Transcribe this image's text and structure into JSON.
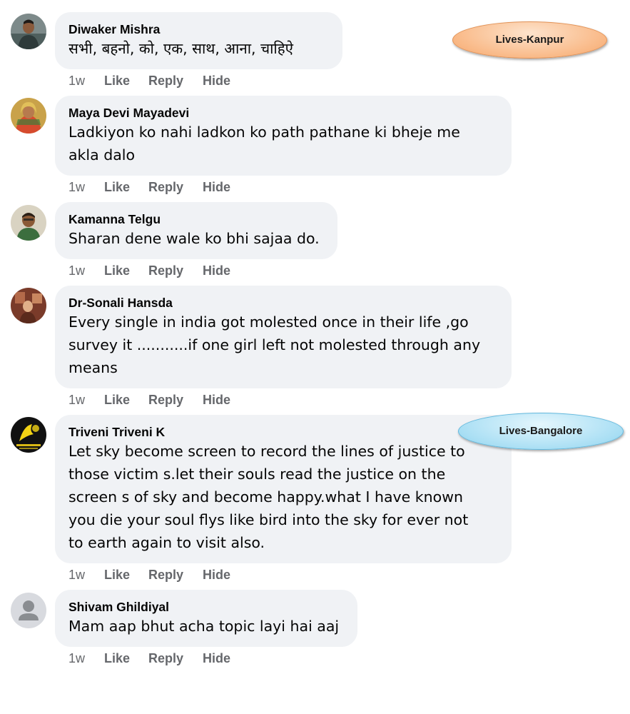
{
  "comments": [
    {
      "author": "Diwaker Mishra",
      "lines": [
        "सभी, बहनो, को, एक, साथ, आना, चाहिऐ"
      ],
      "time": "1w",
      "like": "Like",
      "reply": "Reply",
      "hide": "Hide"
    },
    {
      "author": "Maya Devi Mayadevi",
      "lines": [
        "Ladkiyon ko nahi ladkon ko path pathane ki bheje me",
        "akla dalo"
      ],
      "time": "1w",
      "like": "Like",
      "reply": "Reply",
      "hide": "Hide"
    },
    {
      "author": "Kamanna Telgu",
      "lines": [
        "Sharan dene wale ko bhi sajaa do."
      ],
      "time": "1w",
      "like": "Like",
      "reply": "Reply",
      "hide": "Hide"
    },
    {
      "author": "Dr-Sonali Hansda",
      "lines": [
        "Every single in india got molested once in their life ,go",
        "survey it ...........if one girl left not molested through any",
        "means"
      ],
      "time": "1w",
      "like": "Like",
      "reply": "Reply",
      "hide": "Hide"
    },
    {
      "author": "Triveni Triveni K",
      "lines": [
        "Let sky become screen to record the lines of justice to",
        "those victim s.let their souls read the justice on the",
        "screen s of sky and become happy.what I have known",
        "you die your soul flys like bird into the sky for ever not",
        "to earth again to visit also."
      ],
      "time": "1w",
      "like": "Like",
      "reply": "Reply",
      "hide": "Hide"
    },
    {
      "author": "Shivam Ghildiyal",
      "lines": [
        "Mam aap bhut acha topic layi hai aaj"
      ],
      "time": "1w",
      "like": "Like",
      "reply": "Reply",
      "hide": "Hide"
    }
  ],
  "annotations": {
    "kanpur": "Lives-Kanpur",
    "bangalore": "Lives-Bangalore"
  },
  "colors": {
    "bubble_bg": "#f0f2f5",
    "action_text": "#65676b",
    "kanpur_tag": "#f9b987",
    "bangalore_tag": "#aadff4"
  }
}
